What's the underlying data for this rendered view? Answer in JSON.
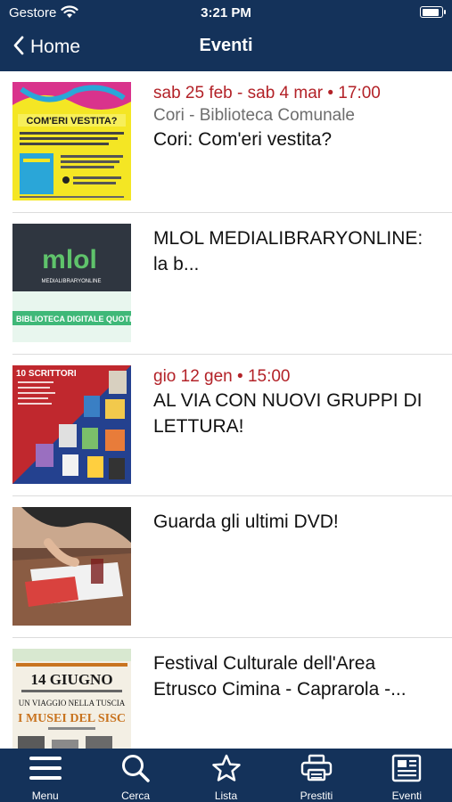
{
  "status_bar": {
    "carrier": "Gestore",
    "time": "3:21 PM",
    "battery_level": 0.9
  },
  "nav": {
    "back_label": "Home",
    "title": "Eventi"
  },
  "events": [
    {
      "date": "sab 25 feb - sab 4 mar • 17:00",
      "place": "Cori - Biblioteca Comunale",
      "title": "Cori: Com'eri vestita?",
      "thumb_text": "COM'ERI VESTITA?"
    },
    {
      "date": "",
      "place": "",
      "title": "MLOL MEDIALIBRARYONLINE: la b...",
      "thumb_text": "mlol",
      "thumb_sub": "MEDIALIBRARYONLINE",
      "thumb_caption": "BIBLIOTECA DIGITALE QUOTIDI"
    },
    {
      "date": "gio 12 gen • 15:00",
      "place": "",
      "title": "AL VIA CON NUOVI GRUPPI DI LETTURA!",
      "thumb_text": "10 SCRITTORI"
    },
    {
      "date": "",
      "place": "",
      "title": "Guarda gli ultimi DVD!"
    },
    {
      "date": "",
      "place": "",
      "title": "Festival Culturale dell'Area Etrusco Cimina - Caprarola -...",
      "thumb_text": "14 GIUGNO",
      "thumb_sub": "I MUSEI DEL SISC",
      "thumb_caption": "UN VIAGGIO NELLA TUSCIA"
    }
  ],
  "tabs": [
    {
      "label": "Menu",
      "icon": "hamburger-icon"
    },
    {
      "label": "Cerca",
      "icon": "search-icon"
    },
    {
      "label": "Lista",
      "icon": "star-icon"
    },
    {
      "label": "Prestiti",
      "icon": "printer-icon"
    },
    {
      "label": "Eventi",
      "icon": "newspaper-icon"
    }
  ]
}
